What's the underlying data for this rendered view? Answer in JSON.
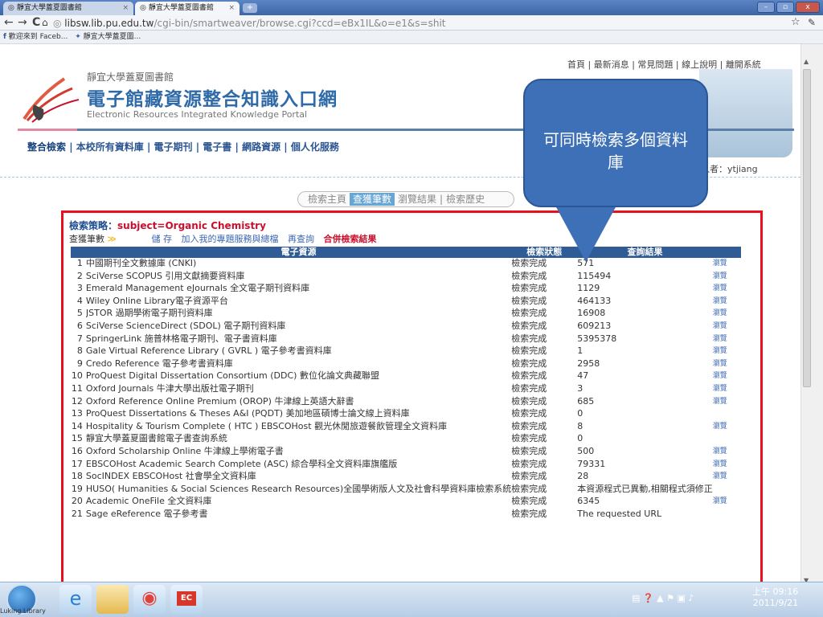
{
  "browser": {
    "tabs": [
      {
        "label": "靜宜大學蓋夏圖書館"
      },
      {
        "label": "靜宜大學蓋夏圖書館"
      }
    ],
    "url_host": "libsw.lib.pu.edu.tw",
    "url_path": "/cgi-bin/smartweaver/browse.cgi?ccd=eBx1IL&o=e1&s=shit",
    "bookmarks": [
      "歡迎來到 Faceb...",
      "靜宜大學蓋夏圖..."
    ]
  },
  "site": {
    "logo_sub": "靜宜大學蓋夏圖書館",
    "logo_main": "電子館藏資源整合知識入口網",
    "logo_en": "Electronic Resources Integrated Knowledge Portal",
    "top_links": [
      "首頁",
      "最新消息",
      "常見問題",
      "線上說明",
      "離開系統"
    ],
    "main_nav": [
      "整合檢索",
      "本校所有資料庫",
      "電子期刊",
      "電子書",
      "網路資源",
      "個人化服務"
    ],
    "user_label": "入者：ytjiang"
  },
  "search_tabs": {
    "home": "檢索主頁",
    "hits": "查獲筆數",
    "browse": "瀏覽結果",
    "history": "檢索歷史"
  },
  "strategy": {
    "label": "檢索策略：",
    "value": "subject=Organic Chemistry"
  },
  "options": {
    "hits_label": "查獲筆數",
    "save": "儲 存",
    "add_to_feed": "加入我的專題服務與總檔",
    "requery": "再查詢",
    "merge": "合併檢索結果"
  },
  "table": {
    "headers": {
      "resource": "電子資源",
      "status": "檢索狀態",
      "result": "查詢結果"
    },
    "rows": [
      {
        "n": "1",
        "src": "中國期刊全文數據庫 (CNKI)",
        "st": "檢索完成",
        "res": "571",
        "br": "瀏覽"
      },
      {
        "n": "2",
        "src": "SciVerse SCOPUS 引用文獻摘要資料庫",
        "st": "檢索完成",
        "res": "115494",
        "br": "瀏覽"
      },
      {
        "n": "3",
        "src": "Emerald Management eJournals 全文電子期刊資料庫",
        "st": "檢索完成",
        "res": "1129",
        "br": "瀏覽"
      },
      {
        "n": "4",
        "src": "Wiley Online Library電子資源平台",
        "st": "檢索完成",
        "res": "464133",
        "br": "瀏覽"
      },
      {
        "n": "5",
        "src": "JSTOR 過期學術電子期刊資料庫",
        "st": "檢索完成",
        "res": "16908",
        "br": "瀏覽"
      },
      {
        "n": "6",
        "src": "SciVerse ScienceDirect (SDOL) 電子期刊資料庫",
        "st": "檢索完成",
        "res": "609213",
        "br": "瀏覽"
      },
      {
        "n": "7",
        "src": "SpringerLink 施普林格電子期刊、電子書資料庫",
        "st": "檢索完成",
        "res": "5395378",
        "br": "瀏覽"
      },
      {
        "n": "8",
        "src": "Gale Virtual Reference Library ( GVRL ) 電子參考書資料庫",
        "st": "檢索完成",
        "res": "1",
        "br": "瀏覽"
      },
      {
        "n": "9",
        "src": "Credo Reference 電子參考書資料庫",
        "st": "檢索完成",
        "res": "2958",
        "br": "瀏覽"
      },
      {
        "n": "10",
        "src": "ProQuest Digital Dissertation Consortium (DDC) 數位化論文典藏聯盟",
        "st": "檢索完成",
        "res": "47",
        "br": "瀏覽"
      },
      {
        "n": "11",
        "src": "Oxford Journals 牛津大學出版社電子期刊",
        "st": "檢索完成",
        "res": "3",
        "br": "瀏覽"
      },
      {
        "n": "12",
        "src": "Oxford Reference Online Premium (OROP) 牛津線上英語大辭書",
        "st": "檢索完成",
        "res": "685",
        "br": "瀏覽"
      },
      {
        "n": "13",
        "src": "ProQuest Dissertations & Theses A&I (PQDT) 美加地區碩博士論文線上資料庫",
        "st": "檢索完成",
        "res": "0",
        "br": ""
      },
      {
        "n": "14",
        "src": "Hospitality & Tourism Complete ( HTC ) EBSCOHost 觀光休閒旅遊餐飲管理全文資料庫",
        "st": "檢索完成",
        "res": "8",
        "br": "瀏覽"
      },
      {
        "n": "15",
        "src": "靜宜大學蓋夏圖書館電子書查詢系統",
        "st": "檢索完成",
        "res": "0",
        "br": ""
      },
      {
        "n": "16",
        "src": "Oxford Scholarship Online 牛津線上學術電子書",
        "st": "檢索完成",
        "res": "500",
        "br": "瀏覽"
      },
      {
        "n": "17",
        "src": "EBSCOHost Academic Search Complete (ASC) 綜合學科全文資料庫旗艦版",
        "st": "檢索完成",
        "res": "79331",
        "br": "瀏覽"
      },
      {
        "n": "18",
        "src": "SocINDEX EBSCOHost 社會學全文資料庫",
        "st": "檢索完成",
        "res": "28",
        "br": "瀏覽"
      },
      {
        "n": "19",
        "src": "HUSO( Humanities & Social Sciences Research Resources)全國學術版人文及社會科學資料庫檢索系統",
        "st": "檢索完成",
        "res": "本資源程式已異動,相關程式須修正",
        "br": ""
      },
      {
        "n": "20",
        "src": "Academic OneFile 全文資料庫",
        "st": "檢索完成",
        "res": "6345",
        "br": "瀏覽"
      },
      {
        "n": "21",
        "src": "Sage eReference 電子參考書",
        "st": "檢索完成",
        "res": "The requested URL",
        "br": ""
      }
    ]
  },
  "callout": {
    "text": "可同時檢索多個資料庫"
  },
  "taskbar": {
    "time": "上午 09:16",
    "date": "2011/9/21",
    "corner_label": "Luking Library"
  },
  "colors": {
    "accent": "#2f5b96",
    "highlight": "#e8101c",
    "callout": "#3e70b7"
  }
}
